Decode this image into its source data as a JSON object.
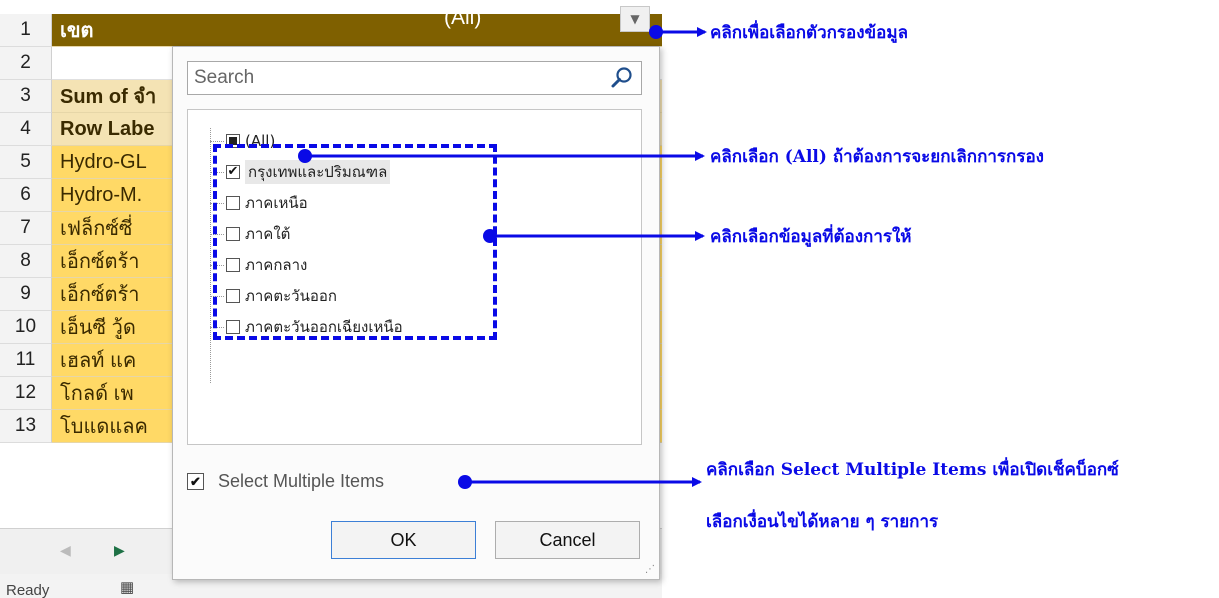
{
  "sheet": {
    "rows": [
      {
        "num": "1",
        "text": "เขต",
        "style": "header"
      },
      {
        "num": "2",
        "text": "",
        "style": "blank"
      },
      {
        "num": "3",
        "text": "Sum of จำ",
        "style": "tan-bold"
      },
      {
        "num": "4",
        "text": "Row Labe",
        "style": "tan-bold"
      },
      {
        "num": "5",
        "text": "Hydro-GL",
        "style": "gold"
      },
      {
        "num": "6",
        "text": "Hydro-M.",
        "style": "gold"
      },
      {
        "num": "7",
        "text": "เฟล็กซ์ซี่",
        "style": "gold"
      },
      {
        "num": "8",
        "text": "เอ็กซ์ตร้า",
        "style": "gold"
      },
      {
        "num": "9",
        "text": "เอ็กซ์ตร้า",
        "style": "gold"
      },
      {
        "num": "10",
        "text": "เอ็นซี วู้ด",
        "style": "gold"
      },
      {
        "num": "11",
        "text": "เฮลท์ แค",
        "style": "gold"
      },
      {
        "num": "12",
        "text": "โกลด์ เพ",
        "style": "gold"
      },
      {
        "num": "13",
        "text": "โบแดแลค",
        "style": "gold"
      }
    ],
    "filter_value": "(All)",
    "status": "Ready"
  },
  "popup": {
    "search_placeholder": "Search",
    "items": [
      {
        "label": "(All)",
        "state": "indeterminate"
      },
      {
        "label": "กรุงเทพและปริมณฑล",
        "state": "checked"
      },
      {
        "label": "ภาคเหนือ",
        "state": "unchecked"
      },
      {
        "label": "ภาคใต้",
        "state": "unchecked"
      },
      {
        "label": "ภาคกลาง",
        "state": "unchecked"
      },
      {
        "label": "ภาคตะวันออก",
        "state": "unchecked"
      },
      {
        "label": "ภาคตะวันออกเฉียงเหนือ",
        "state": "unchecked"
      }
    ],
    "multi_label": "Select Multiple Items",
    "multi_checked": true,
    "ok_label": "OK",
    "cancel_label": "Cancel"
  },
  "annotations": {
    "a1": "คลิกเพื่อเลือกตัวกรองข้อมูล",
    "a2": "คลิกเลือก (All) ถ้าต้องการจะยกเลิกการกรอง",
    "a3": "คลิกเลือกข้อมูลที่ต้องการให้",
    "a4_line1": "คลิกเลือก Select Multiple Items เพื่อเปิดเช็คบ็อกซ์",
    "a4_line2": "เลือกเงื่อนไขได้หลาย ๆ รายการ"
  },
  "colors": {
    "header": "#7f6000",
    "tan": "#f4e3b4",
    "gold": "#ffd966",
    "annotation": "#0a0ae6"
  }
}
